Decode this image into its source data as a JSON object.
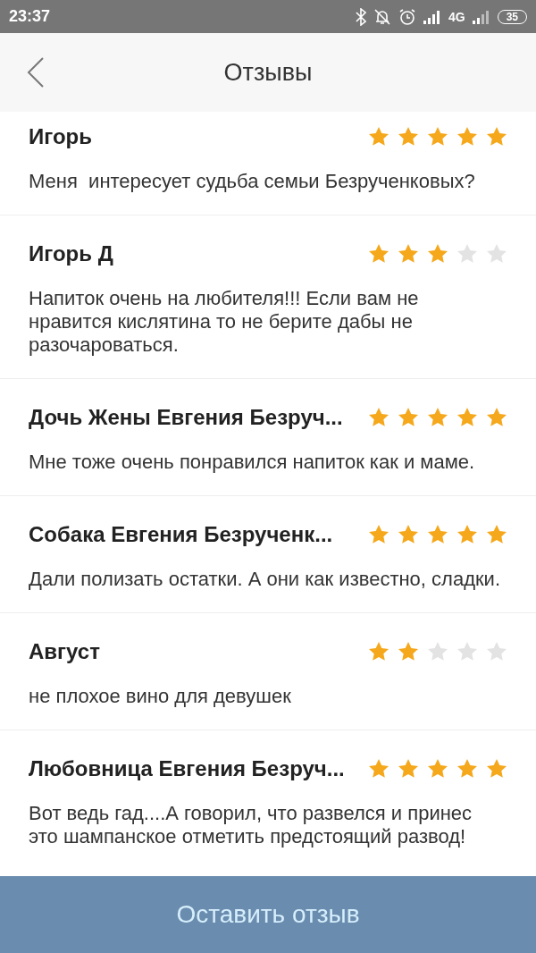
{
  "status_bar": {
    "time": "23:37",
    "network": "4G",
    "battery": "35"
  },
  "header": {
    "title": "Отзывы"
  },
  "reviews": [
    {
      "name": "Игорь",
      "stars": 5,
      "text": "Меня  интересует судьба семьи Безрученковых?"
    },
    {
      "name": "Игорь Д",
      "stars": 3,
      "text": "Напиток очень на любителя!!! Если вам не нравится кислятина то не берите дабы не разочароваться."
    },
    {
      "name": "Дочь Жены Евгения Безруч...",
      "stars": 5,
      "text": "Мне тоже очень понравился напиток как и маме."
    },
    {
      "name": "Собака Евгения Безрученк...",
      "stars": 5,
      "text": "Дали полизать остатки. А они как известно, сладки."
    },
    {
      "name": "Август",
      "stars": 2,
      "text": "не плохое вино для девушек"
    },
    {
      "name": "Любовница Евгения Безруч...",
      "stars": 5,
      "text": "Вот ведь гад....А говорил, что развелся и принес это шампанское отметить предстоящий развод!"
    }
  ],
  "action_button": {
    "label": "Оставить отзыв"
  }
}
